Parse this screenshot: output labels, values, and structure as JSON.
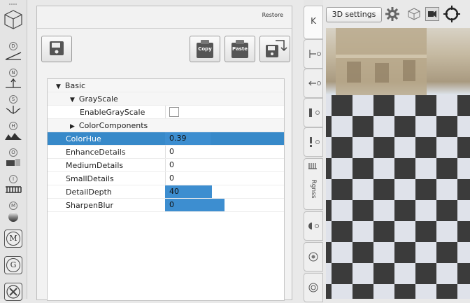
{
  "left_toolbar": {
    "tools": [
      {
        "badge": "D",
        "icon": "wide-angle-distortion-icon"
      },
      {
        "badge": "N",
        "icon": "normal-arrow-icon"
      },
      {
        "badge": "S",
        "icon": "anchor-specular-icon"
      },
      {
        "badge": "H",
        "icon": "height-mountains-icon"
      },
      {
        "badge": "O",
        "icon": "occlusion-icon"
      },
      {
        "badge": "I",
        "icon": "illumination-grid-icon"
      },
      {
        "badge": "M",
        "icon": "material-sphere-icon"
      }
    ],
    "buttons": [
      {
        "label": "M",
        "icon": "material-m-icon"
      },
      {
        "label": "G",
        "icon": "general-g-icon"
      },
      {
        "label": "",
        "icon": "tools-wrench-icon"
      }
    ]
  },
  "panel": {
    "restore_label": "Restore",
    "buttons": [
      {
        "name": "save",
        "label": ""
      },
      {
        "name": "copy",
        "label": "Copy"
      },
      {
        "name": "paste",
        "label": "Paste"
      },
      {
        "name": "save-as",
        "label": ""
      }
    ],
    "tree": {
      "rows": [
        {
          "label": "Basic",
          "indent": 0,
          "type": "group-open",
          "value": ""
        },
        {
          "label": "GrayScale",
          "indent": 1,
          "type": "group-open",
          "value": ""
        },
        {
          "label": "EnableGrayScale",
          "indent": 2,
          "type": "checkbox",
          "value": ""
        },
        {
          "label": "ColorComponents",
          "indent": 1,
          "type": "group-closed",
          "value": ""
        },
        {
          "label": "ColorHue",
          "indent": 1,
          "type": "value",
          "value": "0.39",
          "fraction": 0.39
        },
        {
          "label": "EnhanceDetails",
          "indent": 1,
          "type": "value",
          "value": "0",
          "fraction": 0
        },
        {
          "label": "MediumDetails",
          "indent": 1,
          "type": "value",
          "value": "0",
          "fraction": 0
        },
        {
          "label": "SmallDetails",
          "indent": 1,
          "type": "value",
          "value": "0",
          "fraction": 0
        },
        {
          "label": "DetailDepth",
          "indent": 1,
          "type": "value",
          "value": "40",
          "fraction": 0.4
        },
        {
          "label": "SharpenBlur",
          "indent": 1,
          "type": "value",
          "value": "0",
          "fraction": 0.5
        }
      ],
      "selected": "ColorHue"
    }
  },
  "side_tabs": [
    {
      "name": "tab-k",
      "label": "K"
    },
    {
      "name": "tab-2",
      "label": ""
    },
    {
      "name": "tab-3",
      "label": ""
    },
    {
      "name": "tab-4",
      "label": ""
    },
    {
      "name": "tab-5",
      "label": ""
    },
    {
      "name": "tab-rgnss",
      "label": "Rgnss"
    },
    {
      "name": "tab-7",
      "label": ""
    },
    {
      "name": "tab-8",
      "label": ""
    },
    {
      "name": "tab-9",
      "label": ""
    }
  ],
  "view": {
    "settings_label": "3D settings",
    "icons": [
      "gear-icon",
      "cube-icon",
      "camera-icon",
      "crosshair-icon"
    ]
  },
  "colors": {
    "selection": "#3789c9",
    "value_bar": "#3d8ed0",
    "panel_bg": "#f2f2f2"
  }
}
